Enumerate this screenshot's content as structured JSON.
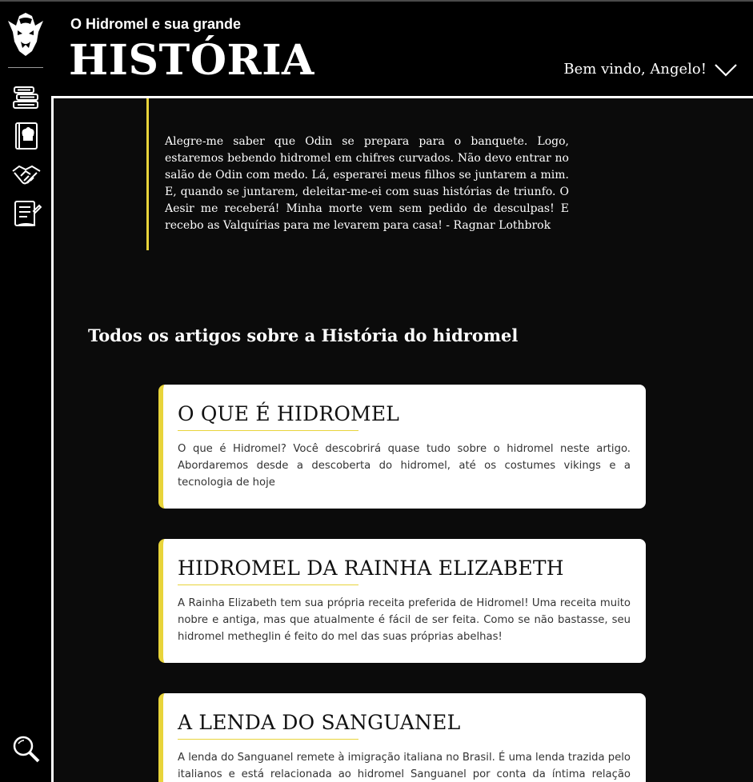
{
  "header": {
    "subtitle": "O Hidromel e sua grande",
    "title": "HISTÓRIA",
    "welcome": "Bem vindo, Angelo!"
  },
  "sidebar": {
    "items": [
      {
        "name": "books",
        "icon": "books-icon"
      },
      {
        "name": "recipe-book",
        "icon": "chef-book-icon"
      },
      {
        "name": "handshake",
        "icon": "handshake-icon"
      },
      {
        "name": "notes",
        "icon": "notes-icon"
      }
    ],
    "search_icon": "magnifier-icon"
  },
  "quote": {
    "text": "Alegre-me saber que Odin se prepara para o banquete. Logo, estaremos bebendo hidromel em chifres curvados. Não devo entrar no salão de Odin com medo. Lá, esperarei meus filhos se juntarem a mim. E, quando se juntarem, deleitar-me-ei com suas histórias de triunfo. O Aesir me receberá! Minha morte vem sem pedido de desculpas! E recebo as Valquírias para me levarem para casa! - Ragnar Lothbrok"
  },
  "section": {
    "title": "Todos os artigos sobre a História do hidromel"
  },
  "articles": [
    {
      "title": "O QUE É HIDROMEL",
      "summary": "O que é Hidromel? Você descobrirá quase tudo sobre o hidromel neste artigo. Abordaremos desde a descoberta do hidromel, até os costumes vikings e a tecnologia de hoje"
    },
    {
      "title": "HIDROMEL DA RAINHA ELIZABETH",
      "summary": "A Rainha Elizabeth tem sua própria receita preferida de Hidromel! Uma receita muito nobre e antiga, mas que atualmente é fácil de ser feita. Como se não bastasse, seu hidromel metheglin é feito do mel das suas próprias abelhas!"
    },
    {
      "title": "A LENDA DO SANGUANEL",
      "summary": "A lenda do Sanguanel remete à imigração italiana no Brasil. É uma lenda trazida pelo italianos e está relacionada ao hidromel Sanguanel por conta da íntima relação dessa"
    }
  ],
  "colors": {
    "accent": "#e8d43a",
    "background": "#000000",
    "panel": "#0b0b0b",
    "card": "#ffffff"
  }
}
